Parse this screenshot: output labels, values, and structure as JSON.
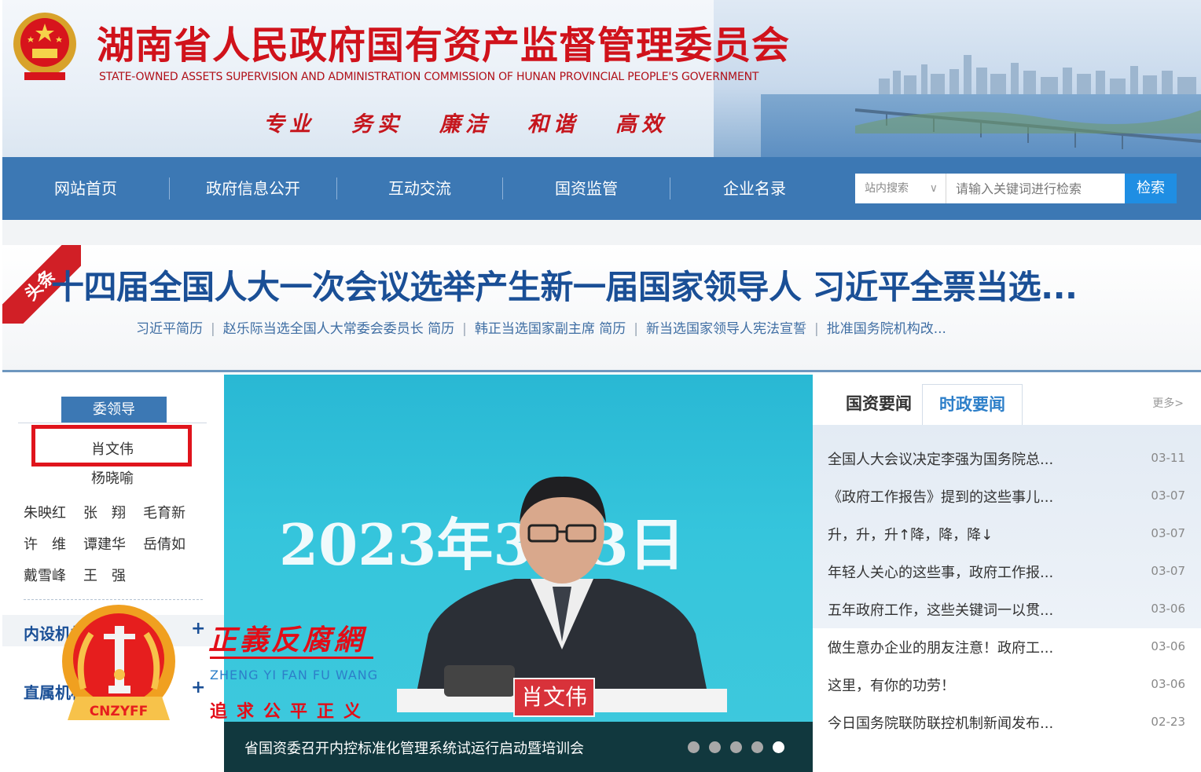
{
  "header": {
    "title_cn": "湖南省人民政府国有资产监督管理委员会",
    "title_en": "STATE-OWNED ASSETS SUPERVISION AND ADMINISTRATION COMMISSION OF HUNAN PROVINCIAL PEOPLE'S GOVERNMENT",
    "mottos": [
      "专业",
      "务实",
      "廉洁",
      "和谐",
      "高效"
    ]
  },
  "nav": {
    "items": [
      "网站首页",
      "政府信息公开",
      "互动交流",
      "国资监管",
      "企业名录"
    ],
    "search": {
      "scope": "站内搜索",
      "placeholder": "请输入关键词进行检索",
      "button": "检索"
    }
  },
  "headline": {
    "badge": "头条",
    "title": "十四届全国人大一次会议选举产生新一届国家领导人 习近平全票当选...",
    "links": [
      "习近平简历",
      "赵乐际当选全国人大常委会委员长 简历",
      "韩正当选国家副主席 简历",
      "新当选国家领导人宪法宣誓",
      "批准国务院机构改..."
    ]
  },
  "leaders": {
    "tab": "委领导",
    "main": "肖文伟",
    "second": "杨晓喻",
    "rows": [
      [
        "朱映红",
        "张　翔",
        "毛育新"
      ],
      [
        "许　维",
        "谭建华",
        "岳倩如"
      ],
      [
        "戴雪峰",
        "王　强"
      ]
    ],
    "sections": [
      {
        "title": "内设机构",
        "plus": "+"
      },
      {
        "title": "直属机构",
        "plus": "+"
      }
    ]
  },
  "watermark": {
    "title": "正義反腐網",
    "subtitle": "ZHENG YI FAN FU WANG",
    "motto": "追求公平正义",
    "logo_text": "CNZYFF"
  },
  "slide": {
    "date_text": "2023年3月3日",
    "nameplate": "肖文伟",
    "caption": "省国资委召开内控标准化管理系统试运行启动暨培训会",
    "dot_count": 5,
    "active_dot": 5
  },
  "news": {
    "tabs": [
      "国资要闻",
      "时政要闻"
    ],
    "more": "更多>",
    "items": [
      {
        "title": "全国人大会议决定李强为国务院总...",
        "date": "03-11"
      },
      {
        "title": "《政府工作报告》提到的这些事儿...",
        "date": "03-07"
      },
      {
        "title": "升，升，升↑降，降，降↓",
        "date": "03-07"
      },
      {
        "title": "年轻人关心的这些事，政府工作报...",
        "date": "03-07"
      },
      {
        "title": "五年政府工作，这些关键词一以贯...",
        "date": "03-06"
      },
      {
        "title": "做生意办企业的朋友注意！政府工...",
        "date": "03-06"
      },
      {
        "title": "这里，有你的功劳！",
        "date": "03-06"
      },
      {
        "title": "今日国务院联防联控机制新闻发布...",
        "date": "02-23"
      }
    ]
  },
  "colors": {
    "brand_red": "#d0121b",
    "nav_blue": "#3c78b4",
    "link_blue": "#1a4f96",
    "accent_blue": "#1f8ee3",
    "highlight_red": "#e0141c"
  }
}
